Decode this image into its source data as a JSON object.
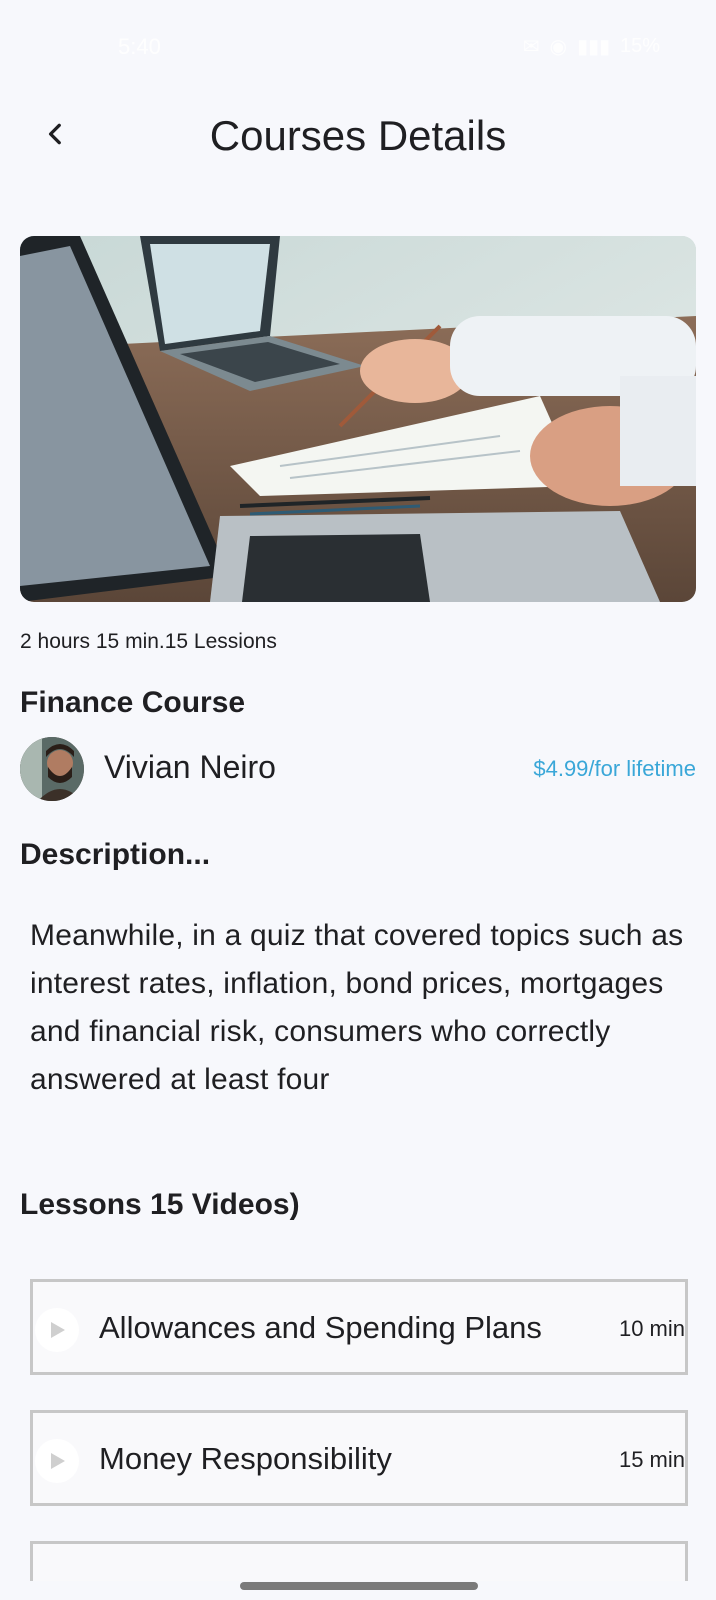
{
  "status_bar": {
    "time": "5:40",
    "battery": "15%"
  },
  "header": {
    "title": "Courses Details"
  },
  "course": {
    "meta": "2 hours 15 min.15 Lessions",
    "title": "Finance Course",
    "instructor": "Vivian Neiro",
    "price": "$4.99/for lifetime"
  },
  "description": {
    "heading": "Description...",
    "body": "Meanwhile, in a quiz that covered topics such as interest rates, inflation, bond prices, mortgages and financial risk, consumers who correctly answered at least four"
  },
  "lessons": {
    "heading": "Lessons 15 Videos)",
    "items": [
      {
        "title": "Allowances and Spending Plans",
        "duration": "10 min"
      },
      {
        "title": "Money Responsibility",
        "duration": "15 min"
      }
    ]
  },
  "colors": {
    "accent": "#3aa7d8",
    "background": "#f7f8fc",
    "border": "#c7c7c7"
  }
}
